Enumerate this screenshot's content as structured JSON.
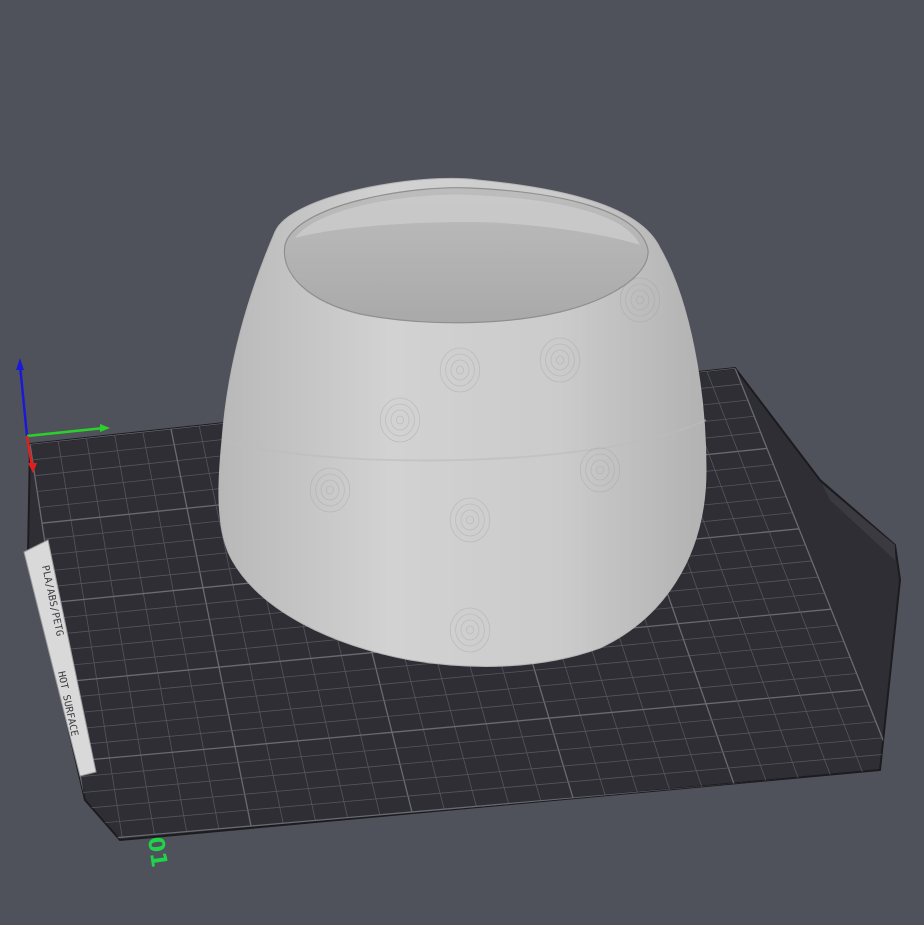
{
  "bed_plate": {
    "material_label": "PLA/ABS/PETG",
    "hot_surface_label": "HOT SURFACE",
    "bed_index": "01"
  },
  "colors": {
    "background": "#50525b",
    "bed": "#2f2f35",
    "grid": "#5a5b62",
    "model": "#c8c8c8",
    "axis_x": "#e02020",
    "axis_y": "#2bd12b",
    "axis_z": "#1a1ad4",
    "bed_index": "#1fd34a"
  }
}
